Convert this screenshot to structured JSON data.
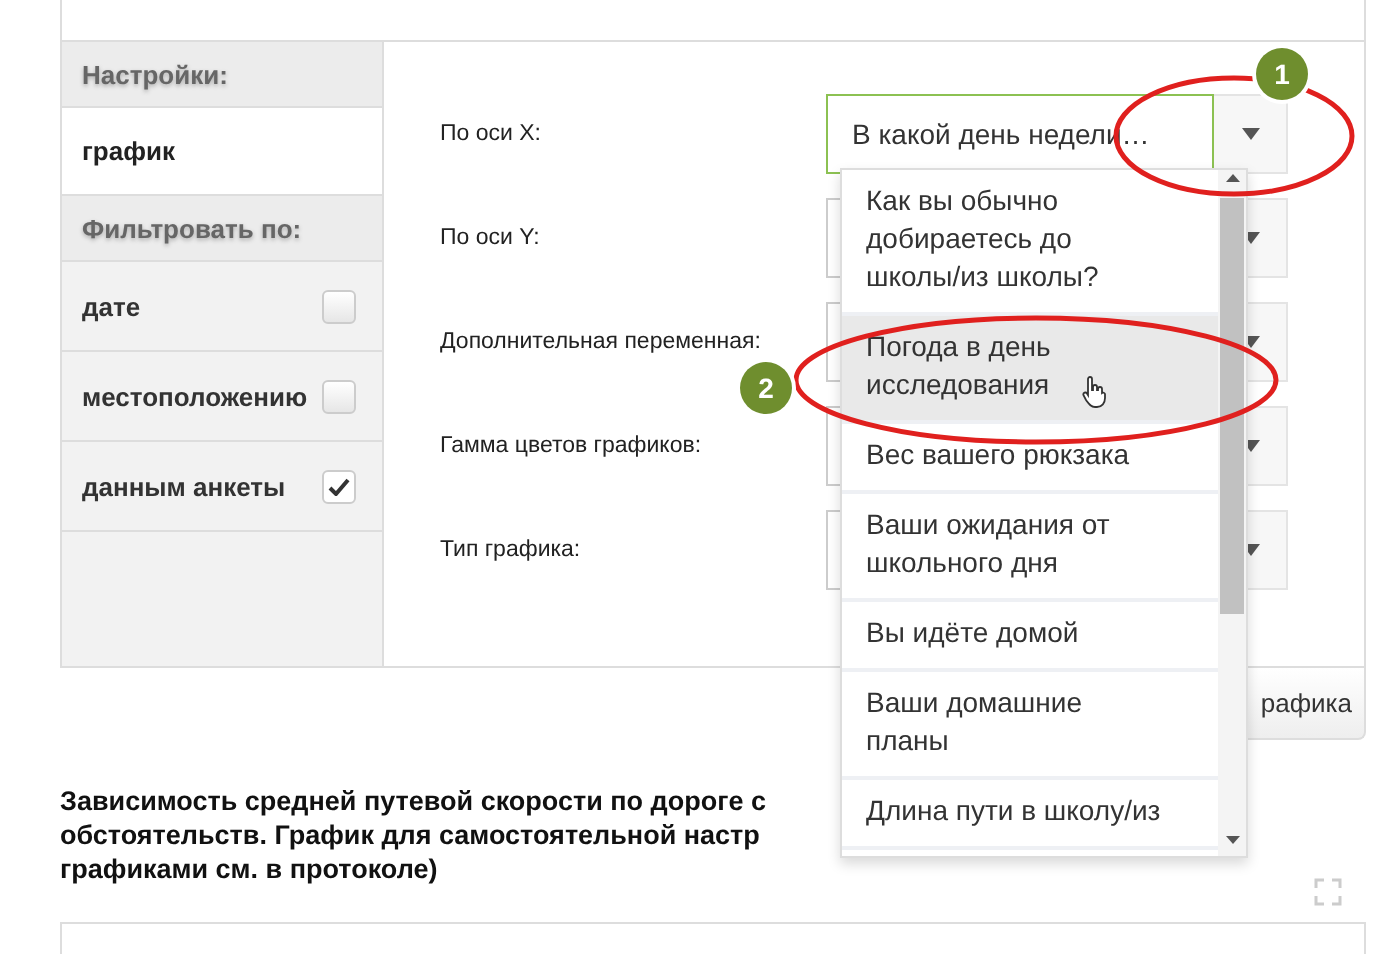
{
  "sidebar": {
    "items": [
      {
        "kind": "header",
        "label": "Настройки:"
      },
      {
        "kind": "tab",
        "label": "график",
        "selected": true
      },
      {
        "kind": "header",
        "label": "Фильтровать по:"
      },
      {
        "kind": "checkbox",
        "label": "дате",
        "checked": false
      },
      {
        "kind": "checkbox",
        "label": "местоположению",
        "checked": false
      },
      {
        "kind": "checkbox",
        "label": "данным анкеты",
        "checked": true
      }
    ]
  },
  "settings": [
    {
      "label": "По оси X:",
      "value": "В какой день недели…",
      "focused": true
    },
    {
      "label": "По оси Y:",
      "focused": false
    },
    {
      "label": "Дополнительная переменная:",
      "focused": false
    },
    {
      "label": "Гамма цветов графиков:",
      "focused": false
    },
    {
      "label": "Тип графика:",
      "focused": false
    }
  ],
  "build_button": {
    "label": "рафика"
  },
  "dropdown": {
    "options": [
      {
        "label": "Как вы обычно добираетесь до школы/из школы?",
        "selected": false
      },
      {
        "label": "Погода в день исследования",
        "selected": true
      },
      {
        "label": "Вес вашего рюкзака",
        "selected": false
      },
      {
        "label": "Ваши ожидания от школьного дня",
        "selected": false
      },
      {
        "label": "Вы идёте домой",
        "selected": false
      },
      {
        "label": "Ваши домашние планы",
        "selected": false
      },
      {
        "label": "Длина пути в школу/из",
        "selected": false
      }
    ]
  },
  "heading": {
    "lines": [
      "Зависимость средней путевой скорости по дороге с",
      "обстоятельств. График для самостоятельной настр",
      "графиками см. в протоколе)"
    ]
  },
  "annotations": [
    {
      "label": "1"
    },
    {
      "label": "2"
    }
  ]
}
